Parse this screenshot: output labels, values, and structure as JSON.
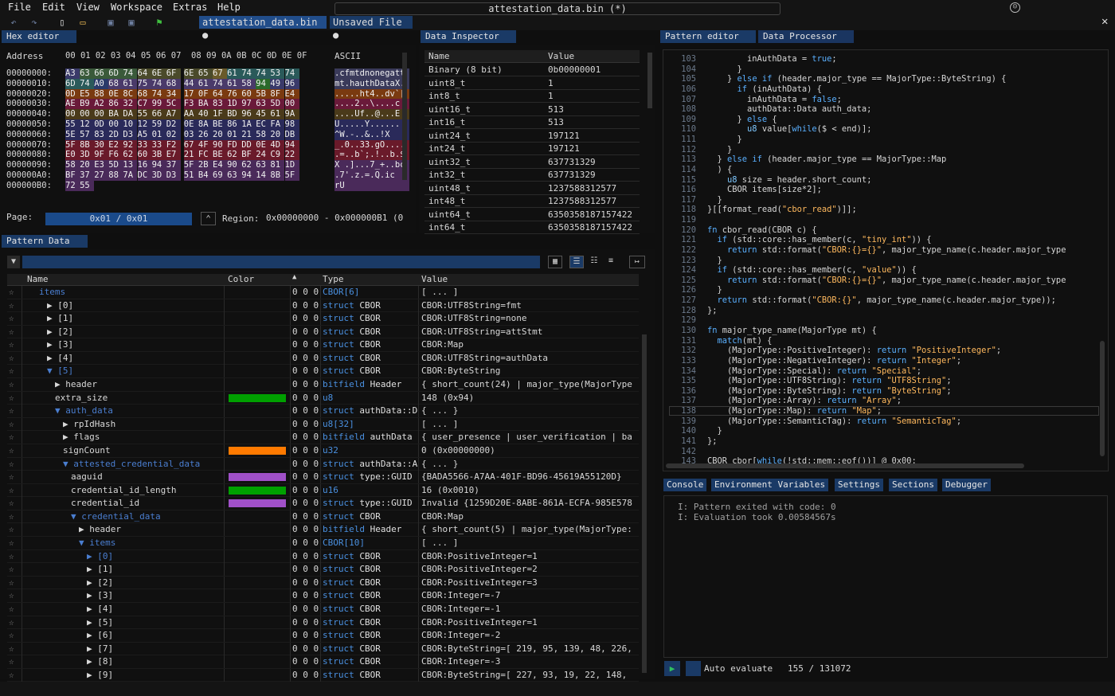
{
  "menu": {
    "file": "File",
    "edit": "Edit",
    "view": "View",
    "workspace": "Workspace",
    "extras": "Extras",
    "help": "Help"
  },
  "window_title": "attestation_data.bin (*)",
  "file_tabs": [
    "attestation_data.bin ●",
    "Unsaved File ●"
  ],
  "panels": {
    "hex": "Hex editor",
    "inspector": "Data Inspector",
    "pattern_editor": "Pattern editor",
    "data_processor": "Data Processor",
    "pattern_data": "Pattern Data"
  },
  "hex": {
    "header_address": "Address",
    "header_cols": "00 01 02 03 04 05 06 07  08 09 0A 0B 0C 0D 0E 0F",
    "header_ascii": "ASCII",
    "rows": [
      {
        "addr": "00000000:",
        "bytes": [
          "A3",
          "63",
          "66",
          "6D",
          "74",
          "64",
          "6E",
          "6F",
          "6E",
          "65",
          "67",
          "61",
          "74",
          "74",
          "53",
          "74"
        ],
        "ascii": ".cfmtdnonegatt"
      },
      {
        "addr": "00000010:",
        "bytes": [
          "6D",
          "74",
          "A0",
          "68",
          "61",
          "75",
          "74",
          "68",
          "44",
          "61",
          "74",
          "61",
          "58",
          "94",
          "49",
          "96"
        ],
        "ascii": "mt.hauthDataX."
      },
      {
        "addr": "00000020:",
        "bytes": [
          "0D",
          "E5",
          "88",
          "0E",
          "8C",
          "68",
          "74",
          "34",
          "17",
          "0F",
          "64",
          "76",
          "60",
          "5B",
          "8F",
          "E4"
        ],
        "ascii": ".....ht4..dv`["
      },
      {
        "addr": "00000030:",
        "bytes": [
          "AE",
          "B9",
          "A2",
          "86",
          "32",
          "C7",
          "99",
          "5C",
          "F3",
          "BA",
          "83",
          "1D",
          "97",
          "63",
          "5D",
          "00"
        ],
        "ascii": "....2..\\....c"
      },
      {
        "addr": "00000040:",
        "bytes": [
          "00",
          "00",
          "00",
          "BA",
          "DA",
          "55",
          "66",
          "A7",
          "AA",
          "40",
          "1F",
          "BD",
          "96",
          "45",
          "61",
          "9A"
        ],
        "ascii": "....Uf..@...E"
      },
      {
        "addr": "00000050:",
        "bytes": [
          "55",
          "12",
          "0D",
          "00",
          "10",
          "12",
          "59",
          "D2",
          "0E",
          "8A",
          "BE",
          "86",
          "1A",
          "EC",
          "FA",
          "98"
        ],
        "ascii": "U.....Y......"
      },
      {
        "addr": "00000060:",
        "bytes": [
          "5E",
          "57",
          "83",
          "2D",
          "D3",
          "A5",
          "01",
          "02",
          "03",
          "26",
          "20",
          "01",
          "21",
          "58",
          "20",
          "DB"
        ],
        "ascii": "^W.-..&..!X"
      },
      {
        "addr": "00000070:",
        "bytes": [
          "5F",
          "8B",
          "30",
          "E2",
          "92",
          "33",
          "33",
          "F2",
          "67",
          "4F",
          "90",
          "FD",
          "DD",
          "0E",
          "4D",
          "94"
        ],
        "ascii": "_.0..33.gO...."
      },
      {
        "addr": "00000080:",
        "bytes": [
          "E0",
          "3D",
          "9F",
          "F6",
          "62",
          "60",
          "3B",
          "E7",
          "21",
          "FC",
          "BE",
          "62",
          "BF",
          "24",
          "C9",
          "22"
        ],
        "ascii": ".=..b`;.!..b.$"
      },
      {
        "addr": "00000090:",
        "bytes": [
          "58",
          "20",
          "E3",
          "5D",
          "13",
          "16",
          "94",
          "37",
          "5F",
          "2B",
          "E4",
          "90",
          "62",
          "63",
          "81",
          "1D"
        ],
        "ascii": "X .]...7_+..bc"
      },
      {
        "addr": "000000A0:",
        "bytes": [
          "BF",
          "37",
          "27",
          "88",
          "7A",
          "DC",
          "3D",
          "D3",
          "51",
          "B4",
          "69",
          "63",
          "94",
          "14",
          "8B",
          "5F"
        ],
        "ascii": ".7'.z.=.Q.ic"
      },
      {
        "addr": "000000B0:",
        "bytes": [
          "72",
          "55"
        ],
        "ascii": "rU"
      }
    ],
    "page_label": "Page:",
    "page_value": "0x01 / 0x01",
    "region_label": "Region:",
    "region_value": "0x00000000 - 0x000000B1 (0"
  },
  "inspector": {
    "col_name": "Name",
    "col_value": "Value",
    "rows": [
      {
        "name": "Binary (8 bit)",
        "value": "0b00000001"
      },
      {
        "name": "uint8_t",
        "value": "1"
      },
      {
        "name": "int8_t",
        "value": "1"
      },
      {
        "name": "uint16_t",
        "value": "513"
      },
      {
        "name": "int16_t",
        "value": "513"
      },
      {
        "name": "uint24_t",
        "value": "197121"
      },
      {
        "name": "int24_t",
        "value": "197121"
      },
      {
        "name": "uint32_t",
        "value": "637731329"
      },
      {
        "name": "int32_t",
        "value": "637731329"
      },
      {
        "name": "uint48_t",
        "value": "1237588312577"
      },
      {
        "name": "int48_t",
        "value": "1237588312577"
      },
      {
        "name": "uint64_t",
        "value": "6350358187157422"
      },
      {
        "name": "int64_t",
        "value": "6350358187157422"
      }
    ]
  },
  "code": [
    {
      "n": "103",
      "t": "        inAuthData = true;"
    },
    {
      "n": "104",
      "t": "      }"
    },
    {
      "n": "105",
      "t": "    } else if (header.major_type == MajorType::ByteString) {"
    },
    {
      "n": "106",
      "t": "      if (inAuthData) {"
    },
    {
      "n": "107",
      "t": "        inAuthData = false;"
    },
    {
      "n": "108",
      "t": "        authData::Data auth_data;"
    },
    {
      "n": "109",
      "t": "      } else {"
    },
    {
      "n": "110",
      "t": "        u8 value[while($ < end)];"
    },
    {
      "n": "111",
      "t": "      }"
    },
    {
      "n": "112",
      "t": "    }"
    },
    {
      "n": "113",
      "t": "  } else if (header.major_type == MajorType::Map"
    },
    {
      "n": "114",
      "t": "  ) {"
    },
    {
      "n": "115",
      "t": "    u8 size = header.short_count;"
    },
    {
      "n": "116",
      "t": "    CBOR items[size*2];"
    },
    {
      "n": "117",
      "t": "  }"
    },
    {
      "n": "118",
      "t": "}[[format_read(\"cbor_read\")]];"
    },
    {
      "n": "119",
      "t": ""
    },
    {
      "n": "120",
      "t": "fn cbor_read(CBOR c) {"
    },
    {
      "n": "121",
      "t": "  if (std::core::has_member(c, \"tiny_int\")) {"
    },
    {
      "n": "122",
      "t": "    return std::format(\"CBOR:{}={}\", major_type_name(c.header.major_type"
    },
    {
      "n": "123",
      "t": "  }"
    },
    {
      "n": "124",
      "t": "  if (std::core::has_member(c, \"value\")) {"
    },
    {
      "n": "125",
      "t": "    return std::format(\"CBOR:{}={}\", major_type_name(c.header.major_type"
    },
    {
      "n": "126",
      "t": "  }"
    },
    {
      "n": "127",
      "t": "  return std::format(\"CBOR:{}\", major_type_name(c.header.major_type));"
    },
    {
      "n": "128",
      "t": "};"
    },
    {
      "n": "129",
      "t": ""
    },
    {
      "n": "130",
      "t": "fn major_type_name(MajorType mt) {"
    },
    {
      "n": "131",
      "t": "  match(mt) {"
    },
    {
      "n": "132",
      "t": "    (MajorType::PositiveInteger): return \"PositiveInteger\";"
    },
    {
      "n": "133",
      "t": "    (MajorType::NegativeInteger): return \"Integer\";"
    },
    {
      "n": "134",
      "t": "    (MajorType::Special): return \"Special\";"
    },
    {
      "n": "135",
      "t": "    (MajorType::UTF8String): return \"UTF8String\";"
    },
    {
      "n": "136",
      "t": "    (MajorType::ByteString): return \"ByteString\";"
    },
    {
      "n": "137",
      "t": "    (MajorType::Array): return \"Array\";"
    },
    {
      "n": "138",
      "t": "    (MajorType::Map): return \"Map\";"
    },
    {
      "n": "139",
      "t": "    (MajorType::SemanticTag): return \"SemanticTag\";"
    },
    {
      "n": "140",
      "t": "  }"
    },
    {
      "n": "141",
      "t": "};"
    },
    {
      "n": "142",
      "t": ""
    },
    {
      "n": "143",
      "t": "CBOR cbor[while(!std::mem::eof())] @ 0x00;"
    }
  ],
  "console_tabs": [
    "Console",
    "Environment Variables",
    "Settings",
    "Sections",
    "Debugger"
  ],
  "console_lines": [
    "I: Pattern exited with code: 0",
    "I: Evaluation took 0.00584567s"
  ],
  "auto_evaluate": "Auto evaluate",
  "cursor_pos": "155 / 131072",
  "pattern_table": {
    "cols": {
      "name": "Name",
      "color": "Color",
      "type": "Type",
      "value": "Value"
    },
    "rows": [
      {
        "indent": 0,
        "arrow": "",
        "name": "items",
        "color": "",
        "off": "",
        "type_kw": "",
        "type": "CBOR[6]",
        "value": "[ ... ]",
        "link": true
      },
      {
        "indent": 1,
        "arrow": "▶",
        "name": "[0]",
        "color": "",
        "type_kw": "struct",
        "type": "CBOR",
        "value": "CBOR:UTF8String=fmt"
      },
      {
        "indent": 1,
        "arrow": "▶",
        "name": "[1]",
        "color": "",
        "type_kw": "struct",
        "type": "CBOR",
        "value": "CBOR:UTF8String=none"
      },
      {
        "indent": 1,
        "arrow": "▶",
        "name": "[2]",
        "color": "",
        "type_kw": "struct",
        "type": "CBOR",
        "value": "CBOR:UTF8String=attStmt"
      },
      {
        "indent": 1,
        "arrow": "▶",
        "name": "[3]",
        "color": "",
        "type_kw": "struct",
        "type": "CBOR",
        "value": "CBOR:Map"
      },
      {
        "indent": 1,
        "arrow": "▶",
        "name": "[4]",
        "color": "",
        "type_kw": "struct",
        "type": "CBOR",
        "value": "CBOR:UTF8String=authData"
      },
      {
        "indent": 1,
        "arrow": "▼",
        "name": "[5]",
        "color": "",
        "type_kw": "struct",
        "type": "CBOR",
        "value": "CBOR:ByteString",
        "link": true
      },
      {
        "indent": 2,
        "arrow": "▶",
        "name": "header",
        "color": "",
        "type_kw": "bitfield",
        "type": "Header",
        "value": "{ short_count(24) | major_type(MajorType"
      },
      {
        "indent": 2,
        "arrow": "",
        "name": "extra_size",
        "color": "#00a000",
        "type_kw": "",
        "type": "u8",
        "value": "148 (0x94)"
      },
      {
        "indent": 2,
        "arrow": "▼",
        "name": "auth_data",
        "color": "",
        "type_kw": "struct",
        "type": "authData::D",
        "value": "{ ... }",
        "link": true
      },
      {
        "indent": 3,
        "arrow": "▶",
        "name": "rpIdHash",
        "color": "",
        "type_kw": "",
        "type": "u8[32]",
        "value": "[ ... ]"
      },
      {
        "indent": 3,
        "arrow": "▶",
        "name": "flags",
        "color": "",
        "type_kw": "bitfield",
        "type": "authData",
        "value": "{ user_presence | user_verification | ba"
      },
      {
        "indent": 3,
        "arrow": "",
        "name": "signCount",
        "color": "#ff7a00",
        "type_kw": "",
        "type": "u32",
        "value": "0 (0x00000000)"
      },
      {
        "indent": 3,
        "arrow": "▼",
        "name": "attested_credential_data",
        "color": "",
        "type_kw": "struct",
        "type": "authData::A",
        "value": "{ ... }",
        "link": true
      },
      {
        "indent": 4,
        "arrow": "",
        "name": "aaguid",
        "color": "#a050c8",
        "type_kw": "struct",
        "type": "type::GUID",
        "value": "{BADA5566-A7AA-401F-BD96-45619A55120D}"
      },
      {
        "indent": 4,
        "arrow": "",
        "name": "credential_id_length",
        "color": "#00a000",
        "type_kw": "",
        "type": "u16",
        "value": "16 (0x0010)"
      },
      {
        "indent": 4,
        "arrow": "",
        "name": "credential_id",
        "color": "#a050c8",
        "type_kw": "struct",
        "type": "type::GUID",
        "value": "Invalid {1259D20E-8ABE-861A-ECFA-985E578"
      },
      {
        "indent": 4,
        "arrow": "▼",
        "name": "credential_data",
        "color": "",
        "type_kw": "struct",
        "type": "CBOR",
        "value": "CBOR:Map",
        "link": true
      },
      {
        "indent": 5,
        "arrow": "▶",
        "name": "header",
        "color": "",
        "type_kw": "bitfield",
        "type": "Header",
        "value": "{ short_count(5) | major_type(MajorType:"
      },
      {
        "indent": 5,
        "arrow": "▼",
        "name": "items",
        "color": "",
        "type_kw": "",
        "type": "CBOR[10]",
        "value": "[ ... ]",
        "link": true
      },
      {
        "indent": 6,
        "arrow": "▶",
        "name": "[0]",
        "color": "",
        "type_kw": "struct",
        "type": "CBOR",
        "value": "CBOR:PositiveInteger=1",
        "link": true
      },
      {
        "indent": 6,
        "arrow": "▶",
        "name": "[1]",
        "color": "",
        "type_kw": "struct",
        "type": "CBOR",
        "value": "CBOR:PositiveInteger=2"
      },
      {
        "indent": 6,
        "arrow": "▶",
        "name": "[2]",
        "color": "",
        "type_kw": "struct",
        "type": "CBOR",
        "value": "CBOR:PositiveInteger=3"
      },
      {
        "indent": 6,
        "arrow": "▶",
        "name": "[3]",
        "color": "",
        "type_kw": "struct",
        "type": "CBOR",
        "value": "CBOR:Integer=-7"
      },
      {
        "indent": 6,
        "arrow": "▶",
        "name": "[4]",
        "color": "",
        "type_kw": "struct",
        "type": "CBOR",
        "value": "CBOR:Integer=-1"
      },
      {
        "indent": 6,
        "arrow": "▶",
        "name": "[5]",
        "color": "",
        "type_kw": "struct",
        "type": "CBOR",
        "value": "CBOR:PositiveInteger=1"
      },
      {
        "indent": 6,
        "arrow": "▶",
        "name": "[6]",
        "color": "",
        "type_kw": "struct",
        "type": "CBOR",
        "value": "CBOR:Integer=-2"
      },
      {
        "indent": 6,
        "arrow": "▶",
        "name": "[7]",
        "color": "",
        "type_kw": "struct",
        "type": "CBOR",
        "value": "CBOR:ByteString=[ 219, 95, 139, 48, 226,"
      },
      {
        "indent": 6,
        "arrow": "▶",
        "name": "[8]",
        "color": "",
        "type_kw": "struct",
        "type": "CBOR",
        "value": "CBOR:Integer=-3"
      },
      {
        "indent": 6,
        "arrow": "▶",
        "name": "[9]",
        "color": "",
        "type_kw": "struct",
        "type": "CBOR",
        "value": "CBOR:ByteString=[ 227, 93, 19, 22, 148,"
      }
    ]
  },
  "colors": {
    "accent": "#1a3a66",
    "tab": "#214d8a",
    "keyword": "#5ab0ff",
    "string": "#ffb95e"
  }
}
